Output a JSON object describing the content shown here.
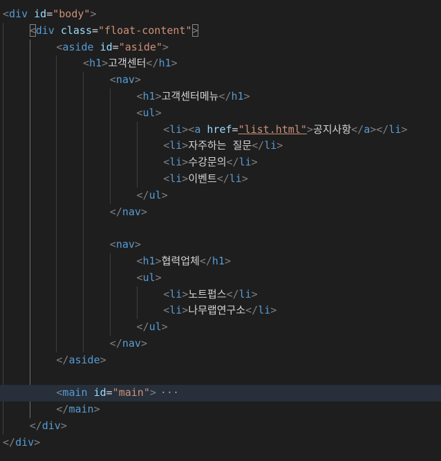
{
  "colors": {
    "background": "#1e1e1e",
    "tag": "#569cd6",
    "punctuation": "#808080",
    "attribute": "#9cdcfe",
    "string": "#ce9178",
    "text": "#d4d4d4",
    "highlight_line": "#262f3a"
  },
  "lines": [
    {
      "indent": 0,
      "tokens": [
        [
          "p",
          "<"
        ],
        [
          "t",
          "div"
        ],
        [
          "x",
          " "
        ],
        [
          "a",
          "id"
        ],
        [
          "x",
          "="
        ],
        [
          "s",
          "\"body\""
        ],
        [
          "p",
          ">"
        ]
      ]
    },
    {
      "indent": 1,
      "tokens": [
        [
          "pb",
          "<"
        ],
        [
          "t",
          "div"
        ],
        [
          "x",
          " "
        ],
        [
          "a",
          "class"
        ],
        [
          "x",
          "="
        ],
        [
          "s",
          "\"float-content\""
        ],
        [
          "pb",
          ">"
        ]
      ]
    },
    {
      "indent": 2,
      "tokens": [
        [
          "p",
          "<"
        ],
        [
          "t",
          "aside"
        ],
        [
          "x",
          " "
        ],
        [
          "a",
          "id"
        ],
        [
          "x",
          "="
        ],
        [
          "s",
          "\"aside\""
        ],
        [
          "p",
          ">"
        ]
      ]
    },
    {
      "indent": 3,
      "tokens": [
        [
          "p",
          "<"
        ],
        [
          "t",
          "h1"
        ],
        [
          "p",
          ">"
        ],
        [
          "x",
          "고객센터"
        ],
        [
          "p",
          "</"
        ],
        [
          "t",
          "h1"
        ],
        [
          "p",
          ">"
        ]
      ]
    },
    {
      "indent": 4,
      "tokens": [
        [
          "p",
          "<"
        ],
        [
          "t",
          "nav"
        ],
        [
          "p",
          ">"
        ]
      ]
    },
    {
      "indent": 5,
      "tokens": [
        [
          "p",
          "<"
        ],
        [
          "t",
          "h1"
        ],
        [
          "p",
          ">"
        ],
        [
          "x",
          "고객센터메뉴"
        ],
        [
          "p",
          "</"
        ],
        [
          "t",
          "h1"
        ],
        [
          "p",
          ">"
        ]
      ]
    },
    {
      "indent": 5,
      "tokens": [
        [
          "p",
          "<"
        ],
        [
          "t",
          "ul"
        ],
        [
          "p",
          ">"
        ]
      ]
    },
    {
      "indent": 6,
      "tokens": [
        [
          "p",
          "<"
        ],
        [
          "t",
          "li"
        ],
        [
          "p",
          ">"
        ],
        [
          "p",
          "<"
        ],
        [
          "t",
          "a"
        ],
        [
          "x",
          " "
        ],
        [
          "a",
          "href"
        ],
        [
          "x",
          "="
        ],
        [
          "sl",
          "\"list.html\""
        ],
        [
          "p",
          ">"
        ],
        [
          "x",
          "공지사항"
        ],
        [
          "p",
          "</"
        ],
        [
          "t",
          "a"
        ],
        [
          "p",
          ">"
        ],
        [
          "p",
          "</"
        ],
        [
          "t",
          "li"
        ],
        [
          "p",
          ">"
        ]
      ]
    },
    {
      "indent": 6,
      "tokens": [
        [
          "p",
          "<"
        ],
        [
          "t",
          "li"
        ],
        [
          "p",
          ">"
        ],
        [
          "x",
          "자주하는 질문"
        ],
        [
          "p",
          "</"
        ],
        [
          "t",
          "li"
        ],
        [
          "p",
          ">"
        ]
      ]
    },
    {
      "indent": 6,
      "tokens": [
        [
          "p",
          "<"
        ],
        [
          "t",
          "li"
        ],
        [
          "p",
          ">"
        ],
        [
          "x",
          "수강문의"
        ],
        [
          "p",
          "</"
        ],
        [
          "t",
          "li"
        ],
        [
          "p",
          ">"
        ]
      ]
    },
    {
      "indent": 6,
      "tokens": [
        [
          "p",
          "<"
        ],
        [
          "t",
          "li"
        ],
        [
          "p",
          ">"
        ],
        [
          "x",
          "이벤트"
        ],
        [
          "p",
          "</"
        ],
        [
          "t",
          "li"
        ],
        [
          "p",
          ">"
        ]
      ]
    },
    {
      "indent": 5,
      "tokens": [
        [
          "p",
          "</"
        ],
        [
          "t",
          "ul"
        ],
        [
          "p",
          ">"
        ]
      ]
    },
    {
      "indent": 4,
      "tokens": [
        [
          "p",
          "</"
        ],
        [
          "t",
          "nav"
        ],
        [
          "p",
          ">"
        ]
      ]
    },
    {
      "indent": 0,
      "tokens": []
    },
    {
      "indent": 4,
      "tokens": [
        [
          "p",
          "<"
        ],
        [
          "t",
          "nav"
        ],
        [
          "p",
          ">"
        ]
      ]
    },
    {
      "indent": 5,
      "tokens": [
        [
          "p",
          "<"
        ],
        [
          "t",
          "h1"
        ],
        [
          "p",
          ">"
        ],
        [
          "x",
          "협력업체"
        ],
        [
          "p",
          "</"
        ],
        [
          "t",
          "h1"
        ],
        [
          "p",
          ">"
        ]
      ]
    },
    {
      "indent": 5,
      "tokens": [
        [
          "p",
          "<"
        ],
        [
          "t",
          "ul"
        ],
        [
          "p",
          ">"
        ]
      ]
    },
    {
      "indent": 6,
      "tokens": [
        [
          "p",
          "<"
        ],
        [
          "t",
          "li"
        ],
        [
          "p",
          ">"
        ],
        [
          "x",
          "노트펍스"
        ],
        [
          "p",
          "</"
        ],
        [
          "t",
          "li"
        ],
        [
          "p",
          ">"
        ]
      ]
    },
    {
      "indent": 6,
      "tokens": [
        [
          "p",
          "<"
        ],
        [
          "t",
          "li"
        ],
        [
          "p",
          ">"
        ],
        [
          "x",
          "나무랩연구소"
        ],
        [
          "p",
          "</"
        ],
        [
          "t",
          "li"
        ],
        [
          "p",
          ">"
        ]
      ]
    },
    {
      "indent": 5,
      "tokens": [
        [
          "p",
          "</"
        ],
        [
          "t",
          "ul"
        ],
        [
          "p",
          ">"
        ]
      ]
    },
    {
      "indent": 4,
      "tokens": [
        [
          "p",
          "</"
        ],
        [
          "t",
          "nav"
        ],
        [
          "p",
          ">"
        ]
      ]
    },
    {
      "indent": 2,
      "tokens": [
        [
          "p",
          "</"
        ],
        [
          "t",
          "aside"
        ],
        [
          "p",
          ">"
        ]
      ]
    },
    {
      "indent": 0,
      "tokens": []
    },
    {
      "indent": 2,
      "highlight": true,
      "fold": "···",
      "tokens": [
        [
          "p",
          "<"
        ],
        [
          "t",
          "main"
        ],
        [
          "x",
          " "
        ],
        [
          "a",
          "id"
        ],
        [
          "x",
          "="
        ],
        [
          "s",
          "\"main\""
        ],
        [
          "p",
          ">"
        ]
      ]
    },
    {
      "indent": 2,
      "tokens": [
        [
          "p",
          "</"
        ],
        [
          "t",
          "main"
        ],
        [
          "p",
          ">"
        ]
      ]
    },
    {
      "indent": 1,
      "tokens": [
        [
          "p",
          "</"
        ],
        [
          "t",
          "div"
        ],
        [
          "p",
          ">"
        ]
      ]
    },
    {
      "indent": 0,
      "tokens": [
        [
          "p",
          "</"
        ],
        [
          "t",
          "div"
        ],
        [
          "p",
          ">"
        ]
      ]
    }
  ]
}
